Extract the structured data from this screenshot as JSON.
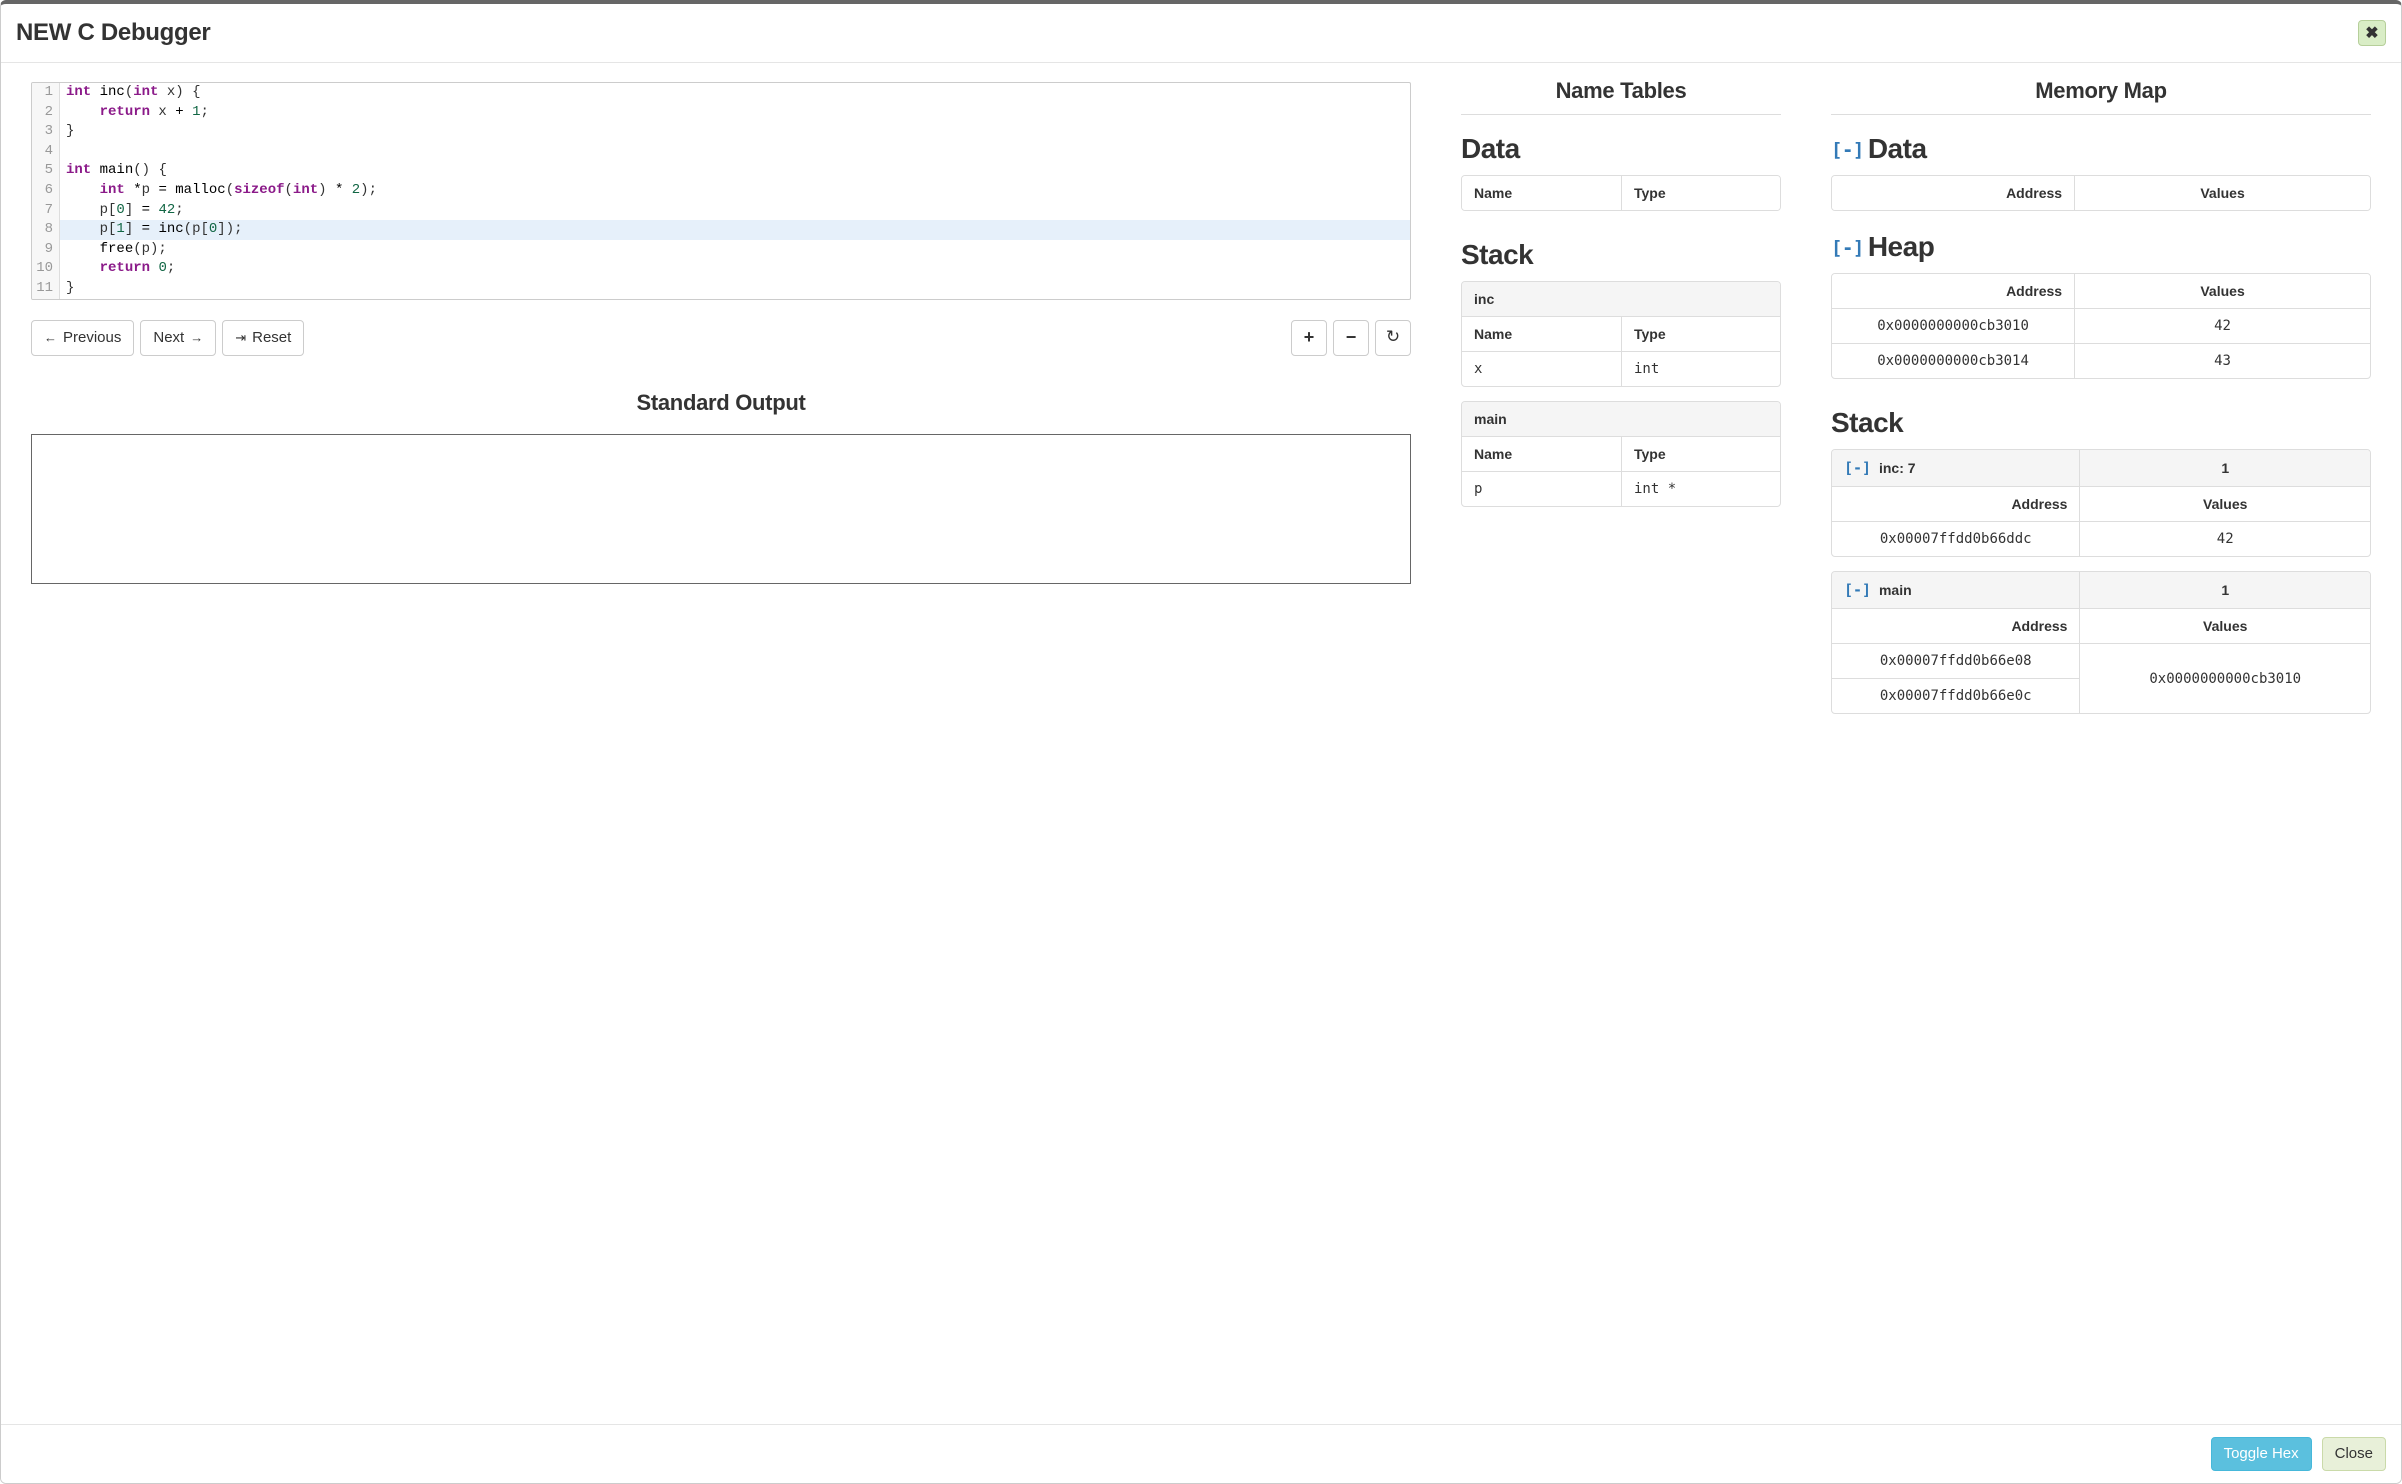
{
  "header": {
    "title": "NEW C Debugger",
    "close_icon": "✖"
  },
  "code": {
    "highlighted_line": 8,
    "lines": [
      {
        "n": 1,
        "tokens": [
          {
            "t": "int",
            "c": "kw"
          },
          {
            "t": " "
          },
          {
            "t": "inc",
            "c": "fn"
          },
          {
            "t": "("
          },
          {
            "t": "int",
            "c": "kw"
          },
          {
            "t": " x) {"
          }
        ]
      },
      {
        "n": 2,
        "tokens": [
          {
            "t": "    "
          },
          {
            "t": "return",
            "c": "kw"
          },
          {
            "t": " x "
          },
          {
            "t": "+",
            "c": "op"
          },
          {
            "t": " "
          },
          {
            "t": "1",
            "c": "num"
          },
          {
            "t": ";"
          }
        ]
      },
      {
        "n": 3,
        "tokens": [
          {
            "t": "}"
          }
        ]
      },
      {
        "n": 4,
        "tokens": []
      },
      {
        "n": 5,
        "tokens": [
          {
            "t": "int",
            "c": "kw"
          },
          {
            "t": " "
          },
          {
            "t": "main",
            "c": "fn"
          },
          {
            "t": "() {"
          }
        ]
      },
      {
        "n": 6,
        "tokens": [
          {
            "t": "    "
          },
          {
            "t": "int",
            "c": "kw"
          },
          {
            "t": " "
          },
          {
            "t": "*",
            "c": "op"
          },
          {
            "t": "p "
          },
          {
            "t": "=",
            "c": "op"
          },
          {
            "t": " "
          },
          {
            "t": "malloc",
            "c": "fn"
          },
          {
            "t": "("
          },
          {
            "t": "sizeof",
            "c": "kw"
          },
          {
            "t": "("
          },
          {
            "t": "int",
            "c": "kw"
          },
          {
            "t": ") "
          },
          {
            "t": "*",
            "c": "op"
          },
          {
            "t": " "
          },
          {
            "t": "2",
            "c": "num"
          },
          {
            "t": ");"
          }
        ]
      },
      {
        "n": 7,
        "tokens": [
          {
            "t": "    p["
          },
          {
            "t": "0",
            "c": "num"
          },
          {
            "t": "] "
          },
          {
            "t": "=",
            "c": "op"
          },
          {
            "t": " "
          },
          {
            "t": "42",
            "c": "num"
          },
          {
            "t": ";"
          }
        ]
      },
      {
        "n": 8,
        "tokens": [
          {
            "t": "    p["
          },
          {
            "t": "1",
            "c": "num"
          },
          {
            "t": "] "
          },
          {
            "t": "=",
            "c": "op"
          },
          {
            "t": " "
          },
          {
            "t": "inc",
            "c": "fn"
          },
          {
            "t": "(p["
          },
          {
            "t": "0",
            "c": "num"
          },
          {
            "t": "]);"
          }
        ]
      },
      {
        "n": 9,
        "tokens": [
          {
            "t": "    "
          },
          {
            "t": "free",
            "c": "fn"
          },
          {
            "t": "(p);"
          }
        ]
      },
      {
        "n": 10,
        "tokens": [
          {
            "t": "    "
          },
          {
            "t": "return",
            "c": "kw"
          },
          {
            "t": " "
          },
          {
            "t": "0",
            "c": "num"
          },
          {
            "t": ";"
          }
        ]
      },
      {
        "n": 11,
        "tokens": [
          {
            "t": "}"
          }
        ]
      }
    ]
  },
  "controls": {
    "previous": "Previous",
    "next": "Next",
    "reset": "Reset",
    "zoom_in": "+",
    "zoom_out": "−",
    "refresh": "↻"
  },
  "stdout": {
    "title": "Standard Output",
    "content": ""
  },
  "name_tables": {
    "title": "Name Tables",
    "data_title": "Data",
    "cols": {
      "name": "Name",
      "type": "Type"
    },
    "stack_title": "Stack",
    "frames": [
      {
        "name": "inc",
        "vars": [
          {
            "name": "x",
            "type": "int"
          }
        ]
      },
      {
        "name": "main",
        "vars": [
          {
            "name": "p",
            "type": "int *"
          }
        ]
      }
    ]
  },
  "memory_map": {
    "title": "Memory Map",
    "toggle_glyph": "[-]",
    "cols": {
      "address": "Address",
      "values": "Values"
    },
    "data": {
      "title": "Data",
      "rows": []
    },
    "heap": {
      "title": "Heap",
      "rows": [
        {
          "address": "0x0000000000cb3010",
          "value": "42"
        },
        {
          "address": "0x0000000000cb3014",
          "value": "43"
        }
      ]
    },
    "stack": {
      "title": "Stack",
      "frames": [
        {
          "name": "inc: 7",
          "count": "1",
          "rows": [
            {
              "address": "0x00007ffdd0b66ddc",
              "value": "42"
            }
          ]
        },
        {
          "name": "main",
          "count": "1",
          "rows": [
            {
              "address": "0x00007ffdd0b66e08",
              "value": "0x0000000000cb3010",
              "rowspan": 2
            },
            {
              "address": "0x00007ffdd0b66e0c"
            }
          ]
        }
      ]
    }
  },
  "footer": {
    "toggle_hex": "Toggle Hex",
    "close": "Close"
  }
}
